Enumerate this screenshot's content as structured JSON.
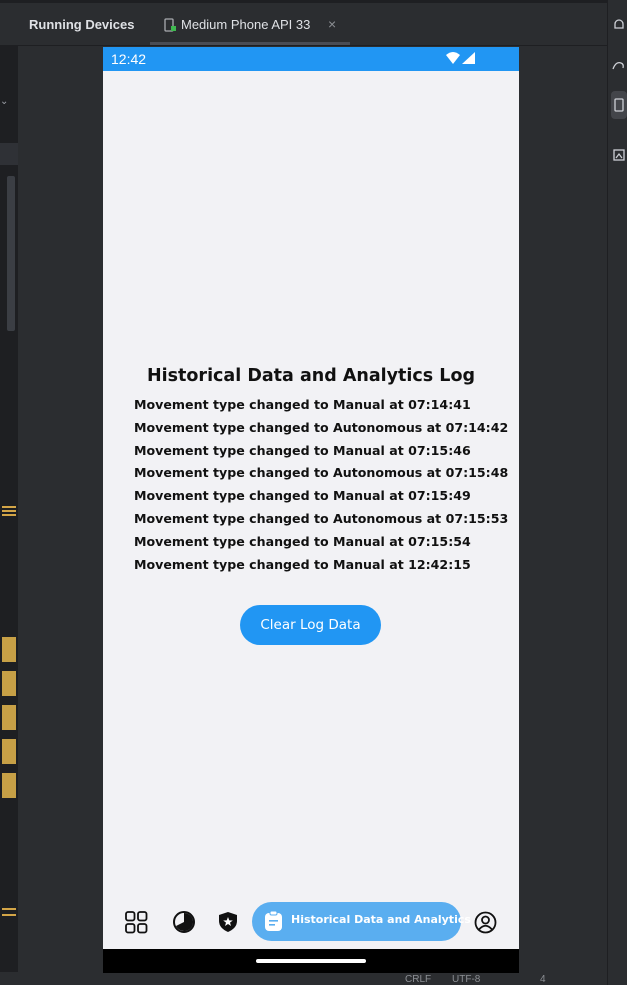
{
  "ide": {
    "tool_window_title": "Running Devices",
    "device_tab": "Medium Phone API 33",
    "tab_close": "×",
    "status_bar": [
      "CRLF",
      "UTF-8",
      "4"
    ]
  },
  "phone": {
    "status_time": "12:42",
    "log_title": "Historical Data and Analytics Log",
    "log_entries": [
      "Movement type changed to Manual at 07:14:41",
      "Movement type changed to Autonomous at 07:14:42",
      "Movement type changed to Manual at 07:15:46",
      "Movement type changed to Autonomous at 07:15:48",
      "Movement type changed to Manual at 07:15:49",
      "Movement type changed to Autonomous at 07:15:53",
      "Movement type changed to Manual at 07:15:54",
      "Movement type changed to Manual at 12:42:15"
    ],
    "clear_button": "Clear Log Data",
    "nav": {
      "items": [
        {
          "icon": "grid-icon"
        },
        {
          "icon": "gauge-icon"
        },
        {
          "icon": "shield-star-icon"
        },
        {
          "icon": "clipboard-icon",
          "label": "Historical Data and Analytics",
          "active": true
        },
        {
          "icon": "user-circle-icon"
        }
      ]
    }
  },
  "colors": {
    "accent": "#2196f3",
    "nav_active": "#5aaef0",
    "screen_bg": "#f2f2f5",
    "ide_bg": "#2b2d30",
    "ide_marker": "#c7a046"
  }
}
